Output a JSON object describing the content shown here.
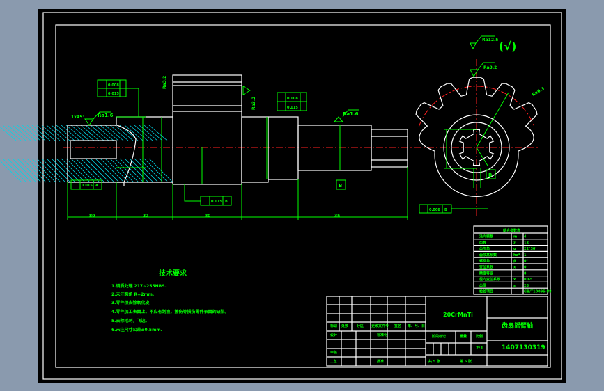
{
  "colors": {
    "background": "#8a9aae",
    "paper": "#000000",
    "outline": "#ffffff",
    "annotation": "#00ff00",
    "centerline": "#ff2020",
    "hatch": "#00d8e8"
  },
  "annotations": {
    "ra_16": "Ra1.6",
    "ra_32": "Ra3.2",
    "ra_125": "Ra12.5",
    "ra_63": "Ra6.3",
    "check": "(√)",
    "datum_b": "B",
    "chamfer": "1x45°",
    "tol_1a": "0.008",
    "tol_1b": "0.015",
    "tol_2a": "0.008",
    "tol_2b": "0.015",
    "tol_3": "0.015",
    "tol_4": "0.015",
    "tol_5": "0.008",
    "sym_a": "A",
    "sym_b": "B",
    "dim_1": "80",
    "dim_2": "32",
    "dim_3": "80",
    "dim_4": "35"
  },
  "tech_requirements": {
    "title": "技术要求",
    "items": [
      "1.调质处理 217~255HBS.",
      "2.未注圆角 R=2mm.",
      "3.零件须去除氧化皮",
      "4.零件加工表面上，不应有划痕、擦伤等损伤零件表面的缺陷。",
      "5.去除毛刺，飞边。",
      "6.未注尺寸公差±0.5mm."
    ]
  },
  "gear_table": {
    "title": "啮合参数表",
    "rows": [
      [
        "法向模数",
        "m",
        "4"
      ],
      [
        "齿数",
        "z",
        "13"
      ],
      [
        "齿形角",
        "α",
        "22°30'"
      ],
      [
        "齿顶高系数",
        "ha*",
        "1"
      ],
      [
        "螺旋角",
        "β",
        "0°"
      ],
      [
        "变位系数",
        "x",
        "0"
      ],
      [
        "精度等级",
        "",
        "8"
      ],
      [
        "径向变位系数",
        "x",
        "0.65"
      ],
      [
        "齿厚",
        "s",
        "28"
      ],
      [
        "检验项目",
        "",
        "GB/T10095-88"
      ]
    ]
  },
  "title_block": {
    "material": "20CrMnTi",
    "part_name": "齿扇摇臂轴",
    "drawing_no": "1407130319",
    "scale": "2:1",
    "headers": [
      "标记",
      "处数",
      "分区",
      "更改文件号",
      "签名",
      "年、月、日"
    ],
    "design": "设计",
    "standard": "标准化",
    "review": "审核",
    "process": "工艺",
    "approve": "批准",
    "stage_mark": "阶段标记",
    "weight": "重量",
    "scale_label": "比例",
    "total_sheets": "共 5 张",
    "sheet_no": "第 5 张"
  }
}
